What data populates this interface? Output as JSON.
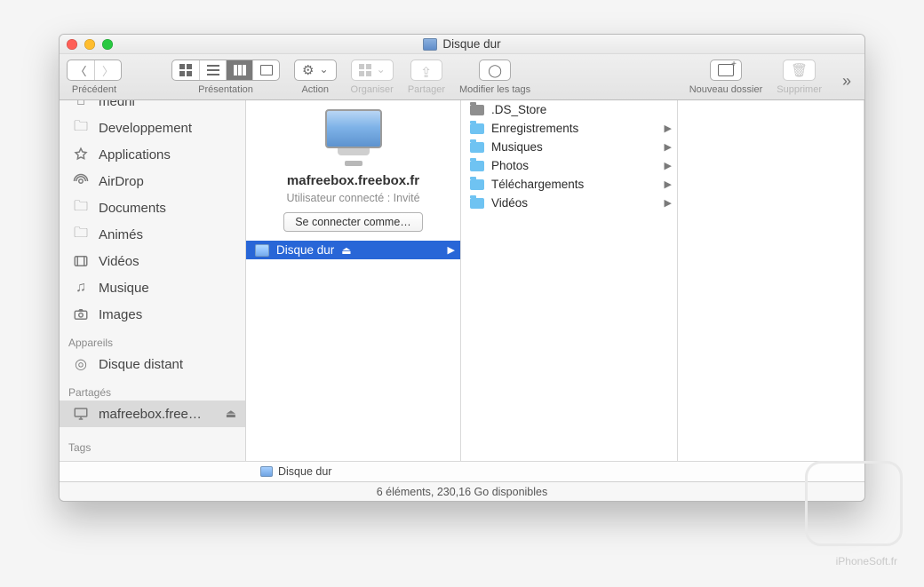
{
  "window": {
    "title": "Disque dur"
  },
  "toolbar": {
    "back_forward_label": "Précédent",
    "view_label": "Présentation",
    "action_label": "Action",
    "arrange_label": "Organiser",
    "share_label": "Partager",
    "tags_label": "Modifier les tags",
    "newfolder_label": "Nouveau dossier",
    "delete_label": "Supprimer"
  },
  "sidebar": {
    "favorites": [
      {
        "label": "medhi",
        "icon": "home"
      },
      {
        "label": "Developpement",
        "icon": "folder"
      },
      {
        "label": "Applications",
        "icon": "app"
      },
      {
        "label": "AirDrop",
        "icon": "airdrop"
      },
      {
        "label": "Documents",
        "icon": "folder"
      },
      {
        "label": "Animés",
        "icon": "folder"
      },
      {
        "label": "Vidéos",
        "icon": "video"
      },
      {
        "label": "Musique",
        "icon": "music"
      },
      {
        "label": "Images",
        "icon": "images"
      }
    ],
    "devices_header": "Appareils",
    "devices": [
      {
        "label": "Disque distant",
        "icon": "disc"
      }
    ],
    "shared_header": "Partagés",
    "shared": [
      {
        "label": "mafreebox.free…",
        "icon": "monitor",
        "ejectable": true
      }
    ],
    "tags_header": "Tags"
  },
  "server": {
    "name": "mafreebox.freebox.fr",
    "subtitle": "Utilisateur connecté : Invité",
    "connect_button": "Se connecter comme…"
  },
  "col1": {
    "items": [
      {
        "label": "Disque dur",
        "ejectable": true,
        "selected": true
      }
    ]
  },
  "col2": {
    "items": [
      {
        "label": ".DS_Store",
        "kind": "file",
        "expandable": false
      },
      {
        "label": "Enregistrements",
        "kind": "folder",
        "expandable": true
      },
      {
        "label": "Musiques",
        "kind": "folder",
        "expandable": true
      },
      {
        "label": "Photos",
        "kind": "folder",
        "expandable": true
      },
      {
        "label": "Téléchargements",
        "kind": "folder",
        "expandable": true
      },
      {
        "label": "Vidéos",
        "kind": "folder",
        "expandable": true
      }
    ]
  },
  "pathbar": {
    "label": "Disque dur"
  },
  "statusbar": {
    "text": "6 éléments, 230,16 Go disponibles"
  },
  "watermark": "iPhoneSoft.fr"
}
